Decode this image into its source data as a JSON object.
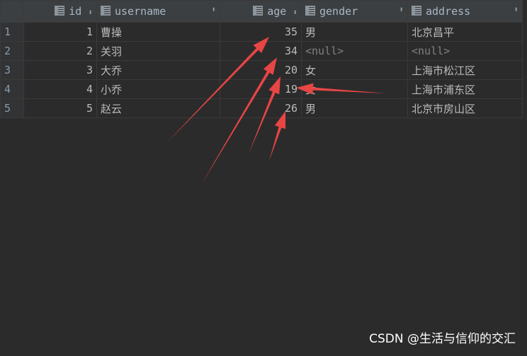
{
  "columns": [
    {
      "label": "id",
      "icon": "table-column-icon"
    },
    {
      "label": "username",
      "icon": "table-column-icon"
    },
    {
      "label": "age",
      "icon": "table-column-icon"
    },
    {
      "label": "gender",
      "icon": "table-column-icon"
    },
    {
      "label": "address",
      "icon": "table-column-icon"
    }
  ],
  "rows": [
    {
      "n": "1",
      "id": "1",
      "username": "曹操",
      "age": "35",
      "gender": "男",
      "address": "北京昌平"
    },
    {
      "n": "2",
      "id": "2",
      "username": "关羽",
      "age": "34",
      "gender": "<null>",
      "address": "<null>"
    },
    {
      "n": "3",
      "id": "3",
      "username": "大乔",
      "age": "20",
      "gender": "女",
      "address": "上海市松江区"
    },
    {
      "n": "4",
      "id": "4",
      "username": "小乔",
      "age": "19",
      "gender": "女",
      "address": "上海市浦东区"
    },
    {
      "n": "5",
      "id": "5",
      "username": "赵云",
      "age": "26",
      "gender": "男",
      "address": "北京市房山区"
    }
  ],
  "watermark": "CSDN @生活与信仰的交汇",
  "annotation_color": "#e84545"
}
